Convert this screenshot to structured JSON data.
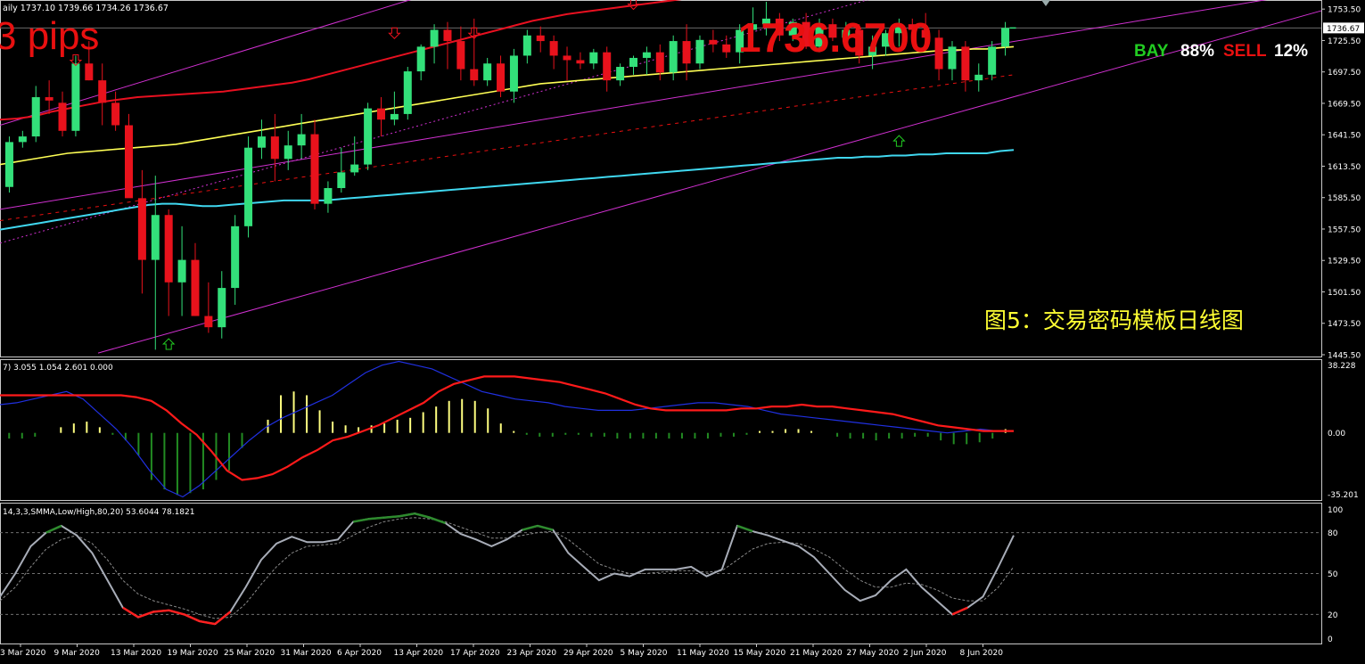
{
  "header": {
    "ohlc_text": "aily  1737.10 1739.66 1734.26 1736.67",
    "pips_text": "3 pips",
    "big_price": "1736.6700",
    "bay_label": "BAY",
    "bay_pct": "88%",
    "sell_label": "SELL",
    "sell_pct": "12%",
    "caption": "图5：交易密码模板日线图"
  },
  "colors": {
    "background": "#000000",
    "bull_candle": "#33e07a",
    "bear_candle": "#e8121c",
    "ma_red": "#e81020",
    "ma_yellow": "#ffff55",
    "ma_cyan": "#40d8f0",
    "channel": "#d030d0",
    "macd_signal": "#ff1a1a",
    "macd_line": "#2030e0",
    "hist_pos": "#ffff80",
    "hist_neg": "#228b22",
    "stoch_main": "#a8adb8",
    "stoch_signal": "#8a8a8a",
    "stoch_ob": "#2e8b2e",
    "stoch_os": "#ff2020",
    "axis_text": "#ffffff",
    "grid": "#555555"
  },
  "chart_data": [
    {
      "type": "candlestick",
      "panel": "price",
      "current_price": 1736.67,
      "ylim": [
        1445.5,
        1760
      ],
      "y_ticks": [
        "1753.50",
        "1725.50",
        "1697.50",
        "1669.50",
        "1641.50",
        "1613.50",
        "1585.50",
        "1557.50",
        "1529.50",
        "1501.50",
        "1473.50",
        "1445.50"
      ],
      "current_price_label": "1736.67",
      "x_ticks": [
        "3 Mar 2020",
        "9 Mar 2020",
        "13 Mar 2020",
        "19 Mar 2020",
        "25 Mar 2020",
        "31 Mar 2020",
        "6 Apr 2020",
        "13 Apr 2020",
        "17 Apr 2020",
        "23 Apr 2020",
        "29 Apr 2020",
        "5 May 2020",
        "11 May 2020",
        "15 May 2020",
        "21 May 2020",
        "27 May 2020",
        "2 Jun 2020",
        "8 Jun 2020"
      ],
      "candles": [
        [
          1595,
          1640,
          1590,
          1635
        ],
        [
          1635,
          1645,
          1630,
          1640
        ],
        [
          1640,
          1685,
          1635,
          1675
        ],
        [
          1675,
          1690,
          1660,
          1672
        ],
        [
          1670,
          1680,
          1640,
          1645
        ],
        [
          1645,
          1712,
          1640,
          1705
        ],
        [
          1705,
          1725,
          1690,
          1690
        ],
        [
          1690,
          1705,
          1650,
          1670
        ],
        [
          1670,
          1680,
          1645,
          1650
        ],
        [
          1650,
          1660,
          1590,
          1585
        ],
        [
          1585,
          1610,
          1500,
          1530
        ],
        [
          1530,
          1605,
          1450,
          1570
        ],
        [
          1570,
          1575,
          1480,
          1510
        ],
        [
          1510,
          1560,
          1480,
          1530
        ],
        [
          1530,
          1545,
          1480,
          1480
        ],
        [
          1480,
          1510,
          1465,
          1470
        ],
        [
          1470,
          1520,
          1460,
          1505
        ],
        [
          1505,
          1570,
          1490,
          1560
        ],
        [
          1560,
          1640,
          1550,
          1630
        ],
        [
          1630,
          1655,
          1620,
          1640
        ],
        [
          1640,
          1660,
          1600,
          1620
        ],
        [
          1620,
          1645,
          1610,
          1632
        ],
        [
          1632,
          1660,
          1620,
          1642
        ],
        [
          1642,
          1655,
          1575,
          1580
        ],
        [
          1580,
          1600,
          1572,
          1594
        ],
        [
          1594,
          1630,
          1590,
          1608
        ],
        [
          1608,
          1640,
          1605,
          1615
        ],
        [
          1615,
          1670,
          1610,
          1665
        ],
        [
          1665,
          1675,
          1640,
          1655
        ],
        [
          1655,
          1680,
          1650,
          1660
        ],
        [
          1660,
          1702,
          1655,
          1698
        ],
        [
          1698,
          1722,
          1690,
          1720
        ],
        [
          1720,
          1740,
          1705,
          1735
        ],
        [
          1735,
          1742,
          1700,
          1725
        ],
        [
          1725,
          1738,
          1690,
          1700
        ],
        [
          1700,
          1745,
          1685,
          1690
        ],
        [
          1690,
          1710,
          1685,
          1705
        ],
        [
          1705,
          1712,
          1675,
          1680
        ],
        [
          1680,
          1718,
          1670,
          1712
        ],
        [
          1712,
          1735,
          1705,
          1730
        ],
        [
          1730,
          1738,
          1715,
          1725
        ],
        [
          1725,
          1730,
          1700,
          1712
        ],
        [
          1712,
          1720,
          1690,
          1708
        ],
        [
          1708,
          1715,
          1700,
          1705
        ],
        [
          1705,
          1718,
          1700,
          1715
        ],
        [
          1715,
          1720,
          1680,
          1690
        ],
        [
          1690,
          1705,
          1685,
          1702
        ],
        [
          1702,
          1712,
          1695,
          1710
        ],
        [
          1710,
          1720,
          1695,
          1715
        ],
        [
          1715,
          1722,
          1690,
          1697
        ],
        [
          1697,
          1730,
          1690,
          1725
        ],
        [
          1725,
          1740,
          1690,
          1705
        ],
        [
          1705,
          1730,
          1700,
          1726
        ],
        [
          1726,
          1735,
          1715,
          1722
        ],
        [
          1722,
          1730,
          1710,
          1715
        ],
        [
          1715,
          1740,
          1705,
          1735
        ],
        [
          1735,
          1755,
          1725,
          1740
        ],
        [
          1740,
          1760,
          1730,
          1745
        ],
        [
          1745,
          1750,
          1725,
          1730
        ],
        [
          1730,
          1745,
          1725,
          1742
        ],
        [
          1742,
          1750,
          1718,
          1720
        ],
        [
          1720,
          1745,
          1715,
          1740
        ],
        [
          1740,
          1745,
          1725,
          1728
        ],
        [
          1728,
          1742,
          1722,
          1735
        ],
        [
          1735,
          1740,
          1705,
          1712
        ],
        [
          1712,
          1730,
          1700,
          1720
        ],
        [
          1720,
          1735,
          1712,
          1732
        ],
        [
          1732,
          1745,
          1720,
          1740
        ],
        [
          1740,
          1745,
          1730,
          1735
        ],
        [
          1735,
          1750,
          1722,
          1728
        ],
        [
          1728,
          1735,
          1690,
          1700
        ],
        [
          1700,
          1725,
          1690,
          1720
        ],
        [
          1720,
          1725,
          1680,
          1690
        ],
        [
          1690,
          1705,
          1680,
          1695
        ],
        [
          1695,
          1725,
          1690,
          1720
        ],
        [
          1720,
          1742,
          1712,
          1736.67
        ]
      ],
      "ma_red": [
        1655,
        1656,
        1658,
        1662,
        1665,
        1668,
        1671,
        1673,
        1675,
        1676,
        1677,
        1678,
        1679,
        1680,
        1682,
        1684,
        1686,
        1688,
        1691,
        1695,
        1699,
        1703,
        1707,
        1711,
        1715,
        1719,
        1723,
        1727,
        1731,
        1735,
        1739,
        1743,
        1746,
        1749,
        1751,
        1753,
        1755,
        1757,
        1759,
        1761,
        1763,
        1765,
        1767,
        1769,
        1771,
        1773,
        1775,
        1777,
        1779,
        1781,
        1783,
        1785,
        1787,
        1789,
        1791,
        1793,
        1795,
        1797,
        1799,
        1801
      ],
      "ma_yellow": [
        1615,
        1617,
        1619,
        1621,
        1623,
        1625,
        1626,
        1627,
        1628,
        1629,
        1630,
        1631,
        1632,
        1633,
        1635,
        1637,
        1639,
        1641,
        1643,
        1645,
        1647,
        1649,
        1651,
        1653,
        1655,
        1657,
        1659,
        1661,
        1663,
        1665,
        1667,
        1669,
        1671,
        1673,
        1675,
        1677,
        1679,
        1681,
        1683,
        1685,
        1687,
        1688,
        1689,
        1690,
        1691,
        1692,
        1693,
        1694,
        1695,
        1696,
        1697,
        1698,
        1699,
        1700,
        1701,
        1702,
        1703,
        1704,
        1705,
        1706,
        1707,
        1708,
        1709,
        1710,
        1711,
        1712,
        1713,
        1714,
        1715,
        1716,
        1717,
        1717,
        1718,
        1718,
        1719,
        1720
      ],
      "ma_cyan": [
        1557,
        1559,
        1561,
        1563,
        1565,
        1567,
        1569,
        1571,
        1573,
        1575,
        1577,
        1579,
        1580,
        1580,
        1579,
        1578,
        1578,
        1579,
        1580,
        1581,
        1582,
        1583,
        1583,
        1583,
        1583,
        1584,
        1585,
        1586,
        1587,
        1588,
        1589,
        1590,
        1591,
        1592,
        1593,
        1594,
        1595,
        1596,
        1597,
        1598,
        1599,
        1600,
        1601,
        1602,
        1603,
        1604,
        1605,
        1606,
        1607,
        1608,
        1609,
        1610,
        1611,
        1612,
        1613,
        1614,
        1615,
        1616,
        1617,
        1618,
        1619,
        1620,
        1621,
        1621,
        1622,
        1622,
        1623,
        1623,
        1624,
        1624,
        1625,
        1625,
        1625,
        1625,
        1627,
        1628
      ]
    },
    {
      "type": "bar",
      "panel": "macd",
      "header_text": "7) 3.055 1.054 2.601 0.000",
      "y_ticks": [
        "38.228",
        "0.00",
        "-35.201"
      ],
      "ylim": [
        -35.201,
        38.228
      ],
      "histogram": [
        -3,
        -3,
        -2,
        0,
        3,
        5,
        6,
        3,
        -1,
        -4,
        -12,
        -25,
        -30,
        -33,
        -32,
        -30,
        -25,
        -20,
        -8,
        0,
        7,
        20,
        22,
        20,
        12,
        6,
        4,
        3,
        4,
        5,
        7,
        8,
        11,
        14,
        17,
        18,
        17,
        13,
        5,
        1,
        -1,
        -2,
        -2,
        -1,
        -1,
        -2,
        -2,
        -3,
        -3,
        -3,
        -3,
        -3,
        -3,
        -3,
        -3,
        -2,
        -2,
        -1,
        1,
        1,
        2,
        2,
        1,
        0,
        -2,
        -3,
        -3,
        -4,
        -3,
        -3,
        -2,
        -2,
        -4,
        -6,
        -6,
        -5,
        -3,
        2
      ],
      "signal": [
        20,
        20,
        20,
        20,
        20,
        20,
        20,
        20,
        20,
        19,
        17,
        12,
        5,
        -1,
        -10,
        -20,
        -25,
        -24,
        -22,
        -18,
        -13,
        -9,
        -4,
        -2,
        1,
        4,
        8,
        12,
        16,
        22,
        26,
        28,
        30,
        30,
        30,
        29,
        28,
        27,
        25,
        23,
        21,
        18,
        15,
        13,
        12,
        12,
        12,
        12,
        12,
        13,
        13,
        14,
        14,
        15,
        14,
        14,
        13,
        12,
        11,
        10,
        8,
        6,
        4,
        3,
        2,
        1,
        1,
        1
      ],
      "macd": [
        15,
        16,
        18,
        20,
        22,
        18,
        10,
        2,
        -8,
        -20,
        -30,
        -34,
        -28,
        -20,
        -12,
        -4,
        3,
        8,
        12,
        16,
        20,
        26,
        32,
        36,
        38,
        36,
        34,
        30,
        26,
        22,
        20,
        18,
        17,
        16,
        14,
        13,
        12,
        12,
        12,
        13,
        14,
        15,
        16,
        16,
        15,
        14,
        12,
        10,
        9,
        8,
        7,
        6,
        5,
        4,
        3,
        2,
        1,
        0,
        1,
        2,
        1,
        1
      ]
    },
    {
      "type": "line",
      "panel": "stochastic",
      "header_text": "14,3,3,SMMA,Low/High,80,20) 53.6044 78.1821",
      "y_ticks": [
        "100",
        "80",
        "50",
        "20",
        "0"
      ],
      "ylim": [
        0,
        100
      ],
      "levels": [
        80,
        50,
        20
      ],
      "main": [
        33,
        50,
        70,
        80,
        85,
        78,
        65,
        45,
        25,
        18,
        22,
        23,
        20,
        15,
        13,
        22,
        40,
        60,
        72,
        77,
        73,
        73,
        75,
        88,
        90,
        91,
        92,
        94,
        91,
        87,
        79,
        75,
        70,
        75,
        82,
        85,
        82,
        65,
        55,
        45,
        50,
        48,
        53,
        53,
        53,
        55,
        48,
        53,
        85,
        81,
        78,
        74,
        70,
        62,
        50,
        38,
        30,
        34,
        45,
        53,
        40,
        30,
        20,
        25,
        33,
        55,
        78
      ],
      "signal": [
        30,
        40,
        55,
        68,
        75,
        78,
        72,
        60,
        45,
        35,
        30,
        27,
        24,
        20,
        17,
        18,
        28,
        42,
        55,
        65,
        70,
        71,
        72,
        78,
        84,
        88,
        90,
        91,
        90,
        88,
        84,
        80,
        76,
        76,
        78,
        80,
        81,
        75,
        66,
        57,
        53,
        50,
        50,
        51,
        52,
        52,
        51,
        52,
        60,
        68,
        72,
        73,
        72,
        68,
        62,
        53,
        45,
        40,
        40,
        43,
        42,
        38,
        32,
        30,
        30,
        40,
        55
      ]
    }
  ]
}
